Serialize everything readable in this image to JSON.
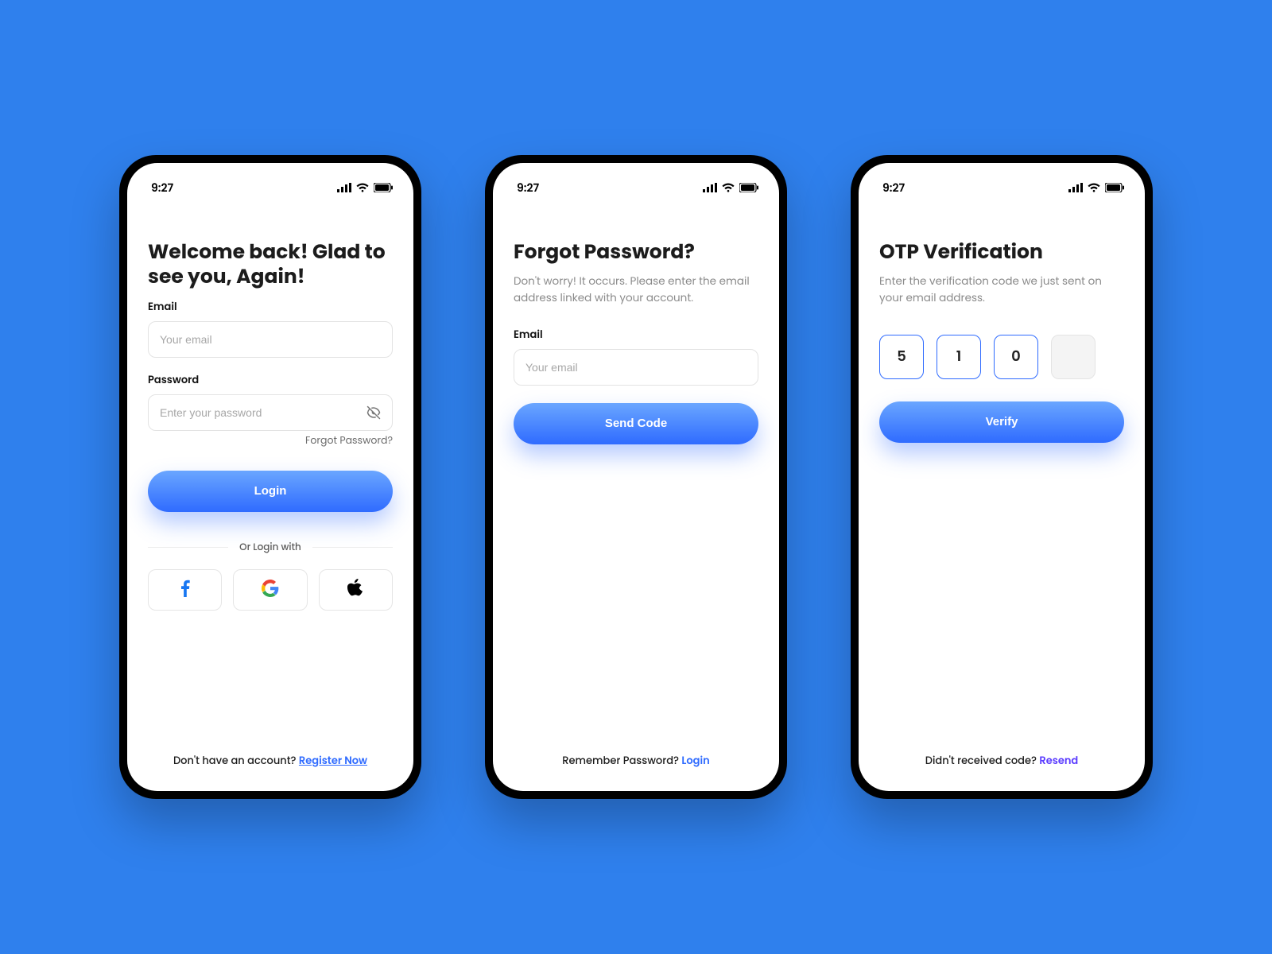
{
  "status": {
    "time": "9:27"
  },
  "login": {
    "title": "Welcome back! Glad to see you, Again!",
    "email_label": "Email",
    "email_placeholder": "Your email",
    "password_label": "Password",
    "password_placeholder": "Enter your password",
    "forgot": "Forgot Password?",
    "login_btn": "Login",
    "or_with": "Or Login with",
    "footer_text": "Don't have an account? ",
    "footer_link": "Register Now"
  },
  "forgot": {
    "title": "Forgot Password?",
    "subtext": "Don't worry! It occurs. Please enter the email address linked with your account.",
    "email_label": "Email",
    "email_placeholder": "Your email",
    "send_btn": "Send Code",
    "footer_text": "Remember Password? ",
    "footer_link": "Login"
  },
  "otp": {
    "title": "OTP Verification",
    "subtext": "Enter the verification code we just sent on your email address.",
    "digits": [
      "5",
      "1",
      "0",
      ""
    ],
    "verify_btn": "Verify",
    "footer_text": "Didn't received code? ",
    "footer_link": "Resend"
  }
}
